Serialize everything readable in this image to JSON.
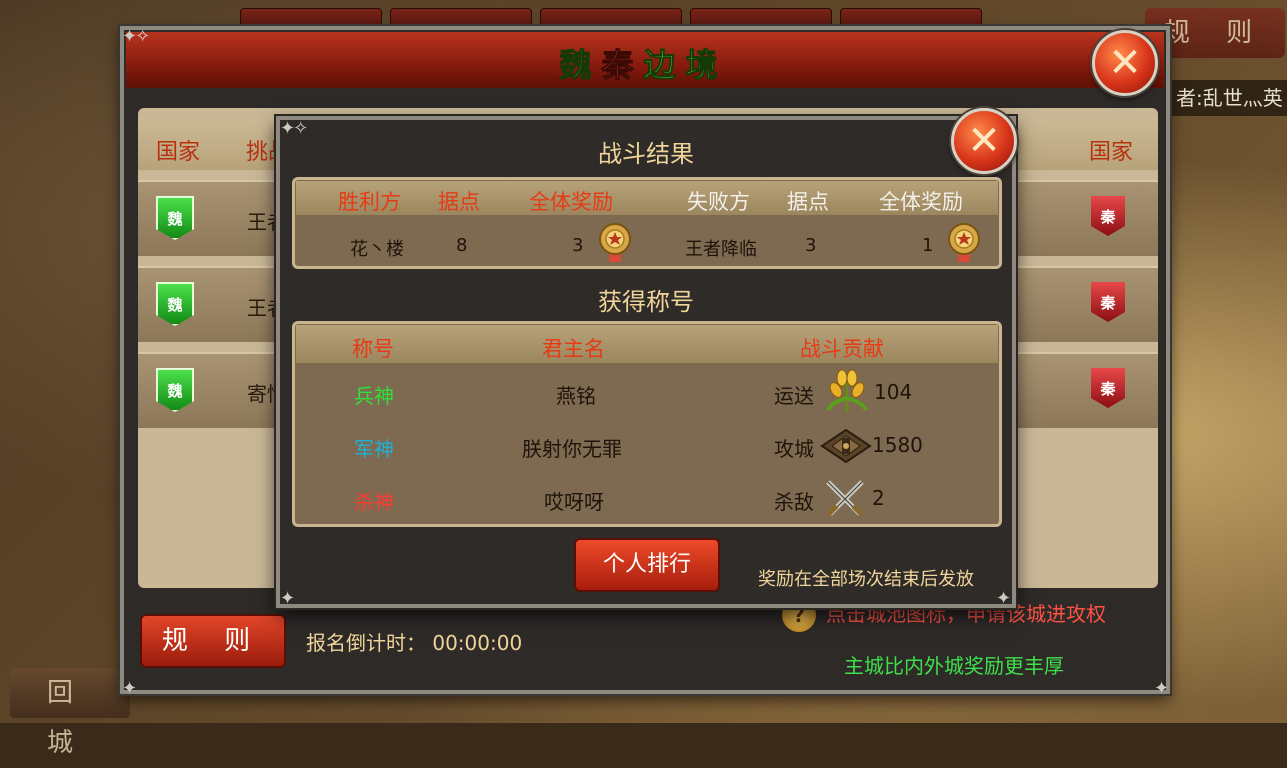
{
  "background": {
    "rule_button": "规 则",
    "side_text": "者:乱世灬英",
    "back_button": "回 城"
  },
  "main_window": {
    "title_part1": "魏",
    "title_part2": "秦",
    "title_part3": "边境",
    "header_country_left": "国家",
    "header_challenge": "挑战",
    "header_country_right": "国家",
    "rows": [
      {
        "left_flag": "魏",
        "name": "王者",
        "right_flag": "秦"
      },
      {
        "left_flag": "魏",
        "name": "王者",
        "right_flag": "秦"
      },
      {
        "left_flag": "魏",
        "name": "寄情",
        "right_flag": "秦"
      }
    ],
    "rule_button": "规 则",
    "countdown_label": "报名倒计时：",
    "countdown_value": "00:00:00",
    "tip_icon": "?",
    "tip_click": "点击城池图标，申请该城进攻权",
    "tip_reward": "主城比内外城奖励更丰厚"
  },
  "popup": {
    "title": "战斗结果",
    "result_headers": {
      "winner": "胜利方",
      "winner_points": "据点",
      "winner_reward": "全体奖励",
      "loser": "失败方",
      "loser_points": "据点",
      "loser_reward": "全体奖励"
    },
    "result_row": {
      "winner": "花丶楼",
      "winner_points": "8",
      "winner_reward": "3",
      "loser": "王者降临",
      "loser_points": "3",
      "loser_reward": "1"
    },
    "titles_section": "获得称号",
    "titles_headers": {
      "title": "称号",
      "lord": "君主名",
      "contribution": "战斗贡献"
    },
    "titles_rows": [
      {
        "title": "兵神",
        "lord": "燕铭",
        "action": "运送",
        "icon": "wheat-icon",
        "value": "104"
      },
      {
        "title": "军神",
        "lord": "朕射你无罪",
        "action": "攻城",
        "icon": "siege-icon",
        "value": "1580"
      },
      {
        "title": "杀神",
        "lord": "哎呀呀",
        "action": "杀敌",
        "icon": "crossed-swords-icon",
        "value": "2"
      }
    ],
    "rank_button": "个人排行",
    "reward_note": "奖励在全部场次结束后发放"
  },
  "colors": {
    "title_green": "#2fe03a",
    "title_blue": "#1fb0d8",
    "title_red": "#ff3a32",
    "header_red": "#e63a14",
    "accent_gold": "#f0d59a"
  }
}
